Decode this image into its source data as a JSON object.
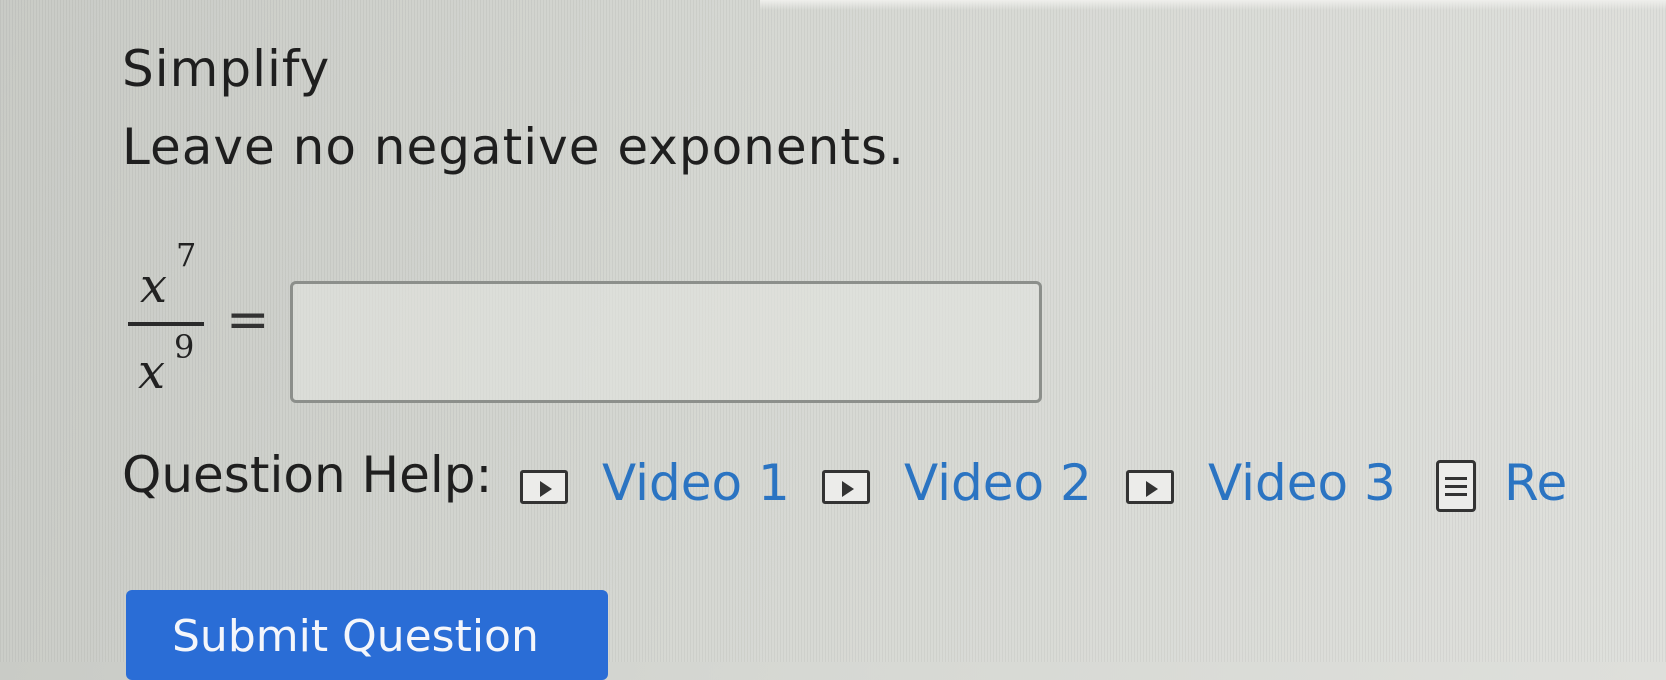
{
  "question": {
    "instruction": "Simplify",
    "note": "Leave no negative exponents.",
    "expression": {
      "numerator_base": "x",
      "numerator_exponent": "7",
      "denominator_base": "x",
      "denominator_exponent": "9",
      "equals": "="
    },
    "answer": {
      "value": "",
      "placeholder": ""
    }
  },
  "help": {
    "label": "Question Help:",
    "links": [
      {
        "label": "Video 1",
        "icon": "video-play-icon"
      },
      {
        "label": "Video 2",
        "icon": "video-play-icon"
      },
      {
        "label": "Video 3",
        "icon": "video-play-icon"
      },
      {
        "label": "Re",
        "icon": "document-icon"
      }
    ]
  },
  "submit": {
    "label": "Submit Question"
  },
  "colors": {
    "link": "#2b74c2",
    "submit_bg": "#2a6dd6"
  }
}
